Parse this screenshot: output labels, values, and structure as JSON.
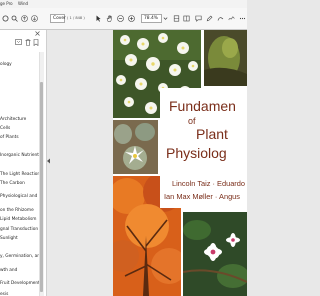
{
  "window": {
    "title_fragment": "ge Pro",
    "menu_fragment": "Wind"
  },
  "toolbar": {
    "page_number": "Cover",
    "page_count": "( 1 / 848 )",
    "zoom": "78.4%"
  },
  "bookmarks": {
    "items": [
      "ology",
      "Architecture",
      "Cells",
      "of Plants",
      "Inorganic Nutrients",
      "The Light Reactions",
      "The Carbon",
      "Physiological and",
      "on the Rhizome",
      "Lipid Metabolism",
      "gnal Transduction",
      "Sunlight",
      "y, Germination, and",
      "wth and",
      "Fruit Development",
      "esis"
    ]
  },
  "cover": {
    "title_line1": "Fundamen",
    "title_line2": "of",
    "title_line3": "Plant",
    "title_line4": "Physiolog",
    "authors_line1": "Lincoln Taiz · Eduardo",
    "authors_line2": "Ian Max Møller · Angus",
    "title_color": "#7a2e1a"
  }
}
